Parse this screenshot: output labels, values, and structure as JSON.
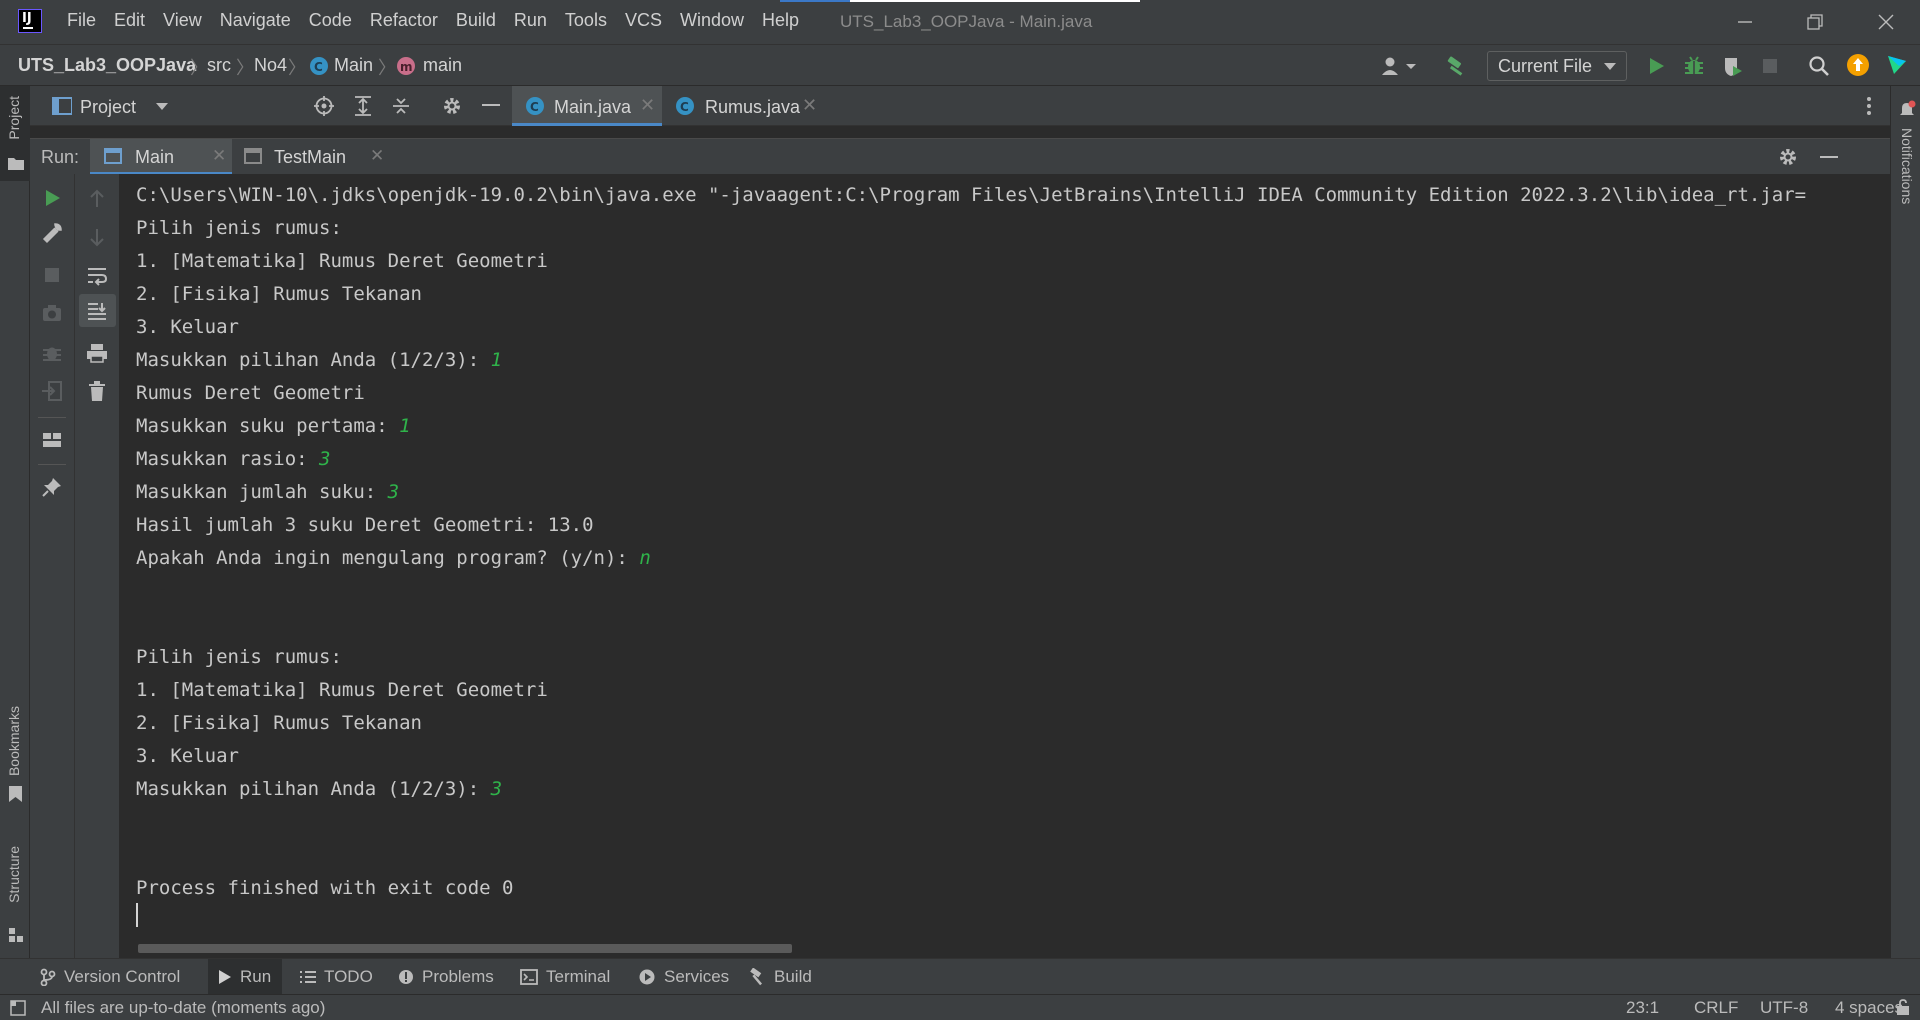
{
  "window": {
    "title": "UTS_Lab3_OOPJava - Main.java",
    "menu": [
      "File",
      "Edit",
      "View",
      "Navigate",
      "Code",
      "Refactor",
      "Build",
      "Run",
      "Tools",
      "VCS",
      "Window",
      "Help"
    ]
  },
  "breadcrumb": {
    "project": "UTS_Lab3_OOPJava",
    "src": "src",
    "package": "No4",
    "class": "Main",
    "method": "main"
  },
  "run_config": {
    "label": "Current File"
  },
  "project_panel": {
    "title": "Project"
  },
  "editor_tabs": [
    {
      "label": "Main.java",
      "active": true
    },
    {
      "label": "Rumus.java",
      "active": false
    }
  ],
  "run_panel": {
    "label": "Run:",
    "tabs": [
      {
        "label": "Main",
        "active": true
      },
      {
        "label": "TestMain",
        "active": false
      }
    ]
  },
  "console": {
    "lines": [
      {
        "text": "C:\\Users\\WIN-10\\.jdks\\openjdk-19.0.2\\bin\\java.exe \"-javaagent:C:\\Program Files\\JetBrains\\IntelliJ IDEA Community Edition 2022.3.2\\lib\\idea_rt.jar=",
        "input": ""
      },
      {
        "text": "Pilih jenis rumus:",
        "input": ""
      },
      {
        "text": "1. [Matematika] Rumus Deret Geometri",
        "input": ""
      },
      {
        "text": "2. [Fisika] Rumus Tekanan",
        "input": ""
      },
      {
        "text": "3. Keluar",
        "input": ""
      },
      {
        "text": "Masukkan pilihan Anda (1/2/3): ",
        "input": "1"
      },
      {
        "text": "Rumus Deret Geometri",
        "input": ""
      },
      {
        "text": "Masukkan suku pertama: ",
        "input": "1"
      },
      {
        "text": "Masukkan rasio: ",
        "input": "3"
      },
      {
        "text": "Masukkan jumlah suku: ",
        "input": "3"
      },
      {
        "text": "Hasil jumlah 3 suku Deret Geometri: 13.0",
        "input": ""
      },
      {
        "text": "Apakah Anda ingin mengulang program? (y/n): ",
        "input": "n"
      },
      {
        "text": "",
        "input": ""
      },
      {
        "text": "",
        "input": ""
      },
      {
        "text": "Pilih jenis rumus:",
        "input": ""
      },
      {
        "text": "1. [Matematika] Rumus Deret Geometri",
        "input": ""
      },
      {
        "text": "2. [Fisika] Rumus Tekanan",
        "input": ""
      },
      {
        "text": "3. Keluar",
        "input": ""
      },
      {
        "text": "Masukkan pilihan Anda (1/2/3): ",
        "input": "3"
      },
      {
        "text": "",
        "input": ""
      },
      {
        "text": "",
        "input": ""
      },
      {
        "text": "Process finished with exit code 0",
        "input": ""
      }
    ]
  },
  "left_stripe": {
    "project": "Project",
    "bookmarks": "Bookmarks",
    "structure": "Structure"
  },
  "right_stripe": {
    "notifications": "Notifications"
  },
  "bottom_tools": [
    "Version Control",
    "Run",
    "TODO",
    "Problems",
    "Terminal",
    "Services",
    "Build"
  ],
  "status_bar": {
    "message": "All files are up-to-date (moments ago)",
    "position": "23:1",
    "line_separator": "CRLF",
    "encoding": "UTF-8",
    "indent": "4 spaces"
  },
  "colors": {
    "accent": "#4a88c7",
    "run_green": "#499c54",
    "console_input": "#2fb34a"
  }
}
